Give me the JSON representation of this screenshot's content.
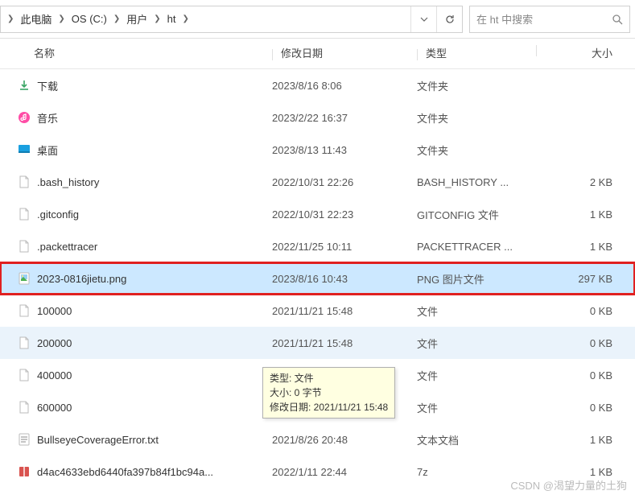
{
  "breadcrumb": [
    "此电脑",
    "OS (C:)",
    "用户",
    "ht"
  ],
  "search": {
    "placeholder": "在 ht 中搜索"
  },
  "columns": {
    "name": "名称",
    "date": "修改日期",
    "type": "类型",
    "size": "大小"
  },
  "rows": [
    {
      "icon": "download-folder",
      "name": "下载",
      "date": "2023/8/16 8:06",
      "type": "文件夹",
      "size": ""
    },
    {
      "icon": "music-folder",
      "name": "音乐",
      "date": "2023/2/22 16:37",
      "type": "文件夹",
      "size": ""
    },
    {
      "icon": "desktop-folder",
      "name": "桌面",
      "date": "2023/8/13 11:43",
      "type": "文件夹",
      "size": ""
    },
    {
      "icon": "file",
      "name": ".bash_history",
      "date": "2022/10/31 22:26",
      "type": "BASH_HISTORY ...",
      "size": "2 KB"
    },
    {
      "icon": "file",
      "name": ".gitconfig",
      "date": "2022/10/31 22:23",
      "type": "GITCONFIG 文件",
      "size": "1 KB"
    },
    {
      "icon": "file",
      "name": ".packettracer",
      "date": "2022/11/25 10:11",
      "type": "PACKETTRACER ...",
      "size": "1 KB"
    },
    {
      "icon": "png",
      "name": "2023-0816jietu.png",
      "date": "2023/8/16 10:43",
      "type": "PNG 图片文件",
      "size": "297 KB",
      "highlighted": true
    },
    {
      "icon": "file",
      "name": "100000",
      "date": "2021/11/21 15:48",
      "type": "文件",
      "size": "0 KB"
    },
    {
      "icon": "file",
      "name": "200000",
      "date": "2021/11/21 15:48",
      "type": "文件",
      "size": "0 KB",
      "hovered": true
    },
    {
      "icon": "file",
      "name": "400000",
      "date": "",
      "type": "文件",
      "size": "0 KB"
    },
    {
      "icon": "file",
      "name": "600000",
      "date": "",
      "type": "文件",
      "size": "0 KB"
    },
    {
      "icon": "text",
      "name": "BullseyeCoverageError.txt",
      "date": "2021/8/26 20:48",
      "type": "文本文档",
      "size": "1 KB"
    },
    {
      "icon": "archive",
      "name": "d4ac4633ebd6440fa397b84f1bc94a...",
      "date": "2022/1/11 22:44",
      "type": "7z",
      "size": "1 KB"
    }
  ],
  "tooltip": {
    "line1": "类型: 文件",
    "line2": "大小: 0 字节",
    "line3": "修改日期: 2021/11/21 15:48"
  },
  "watermark": "CSDN @渴望力量的土狗"
}
